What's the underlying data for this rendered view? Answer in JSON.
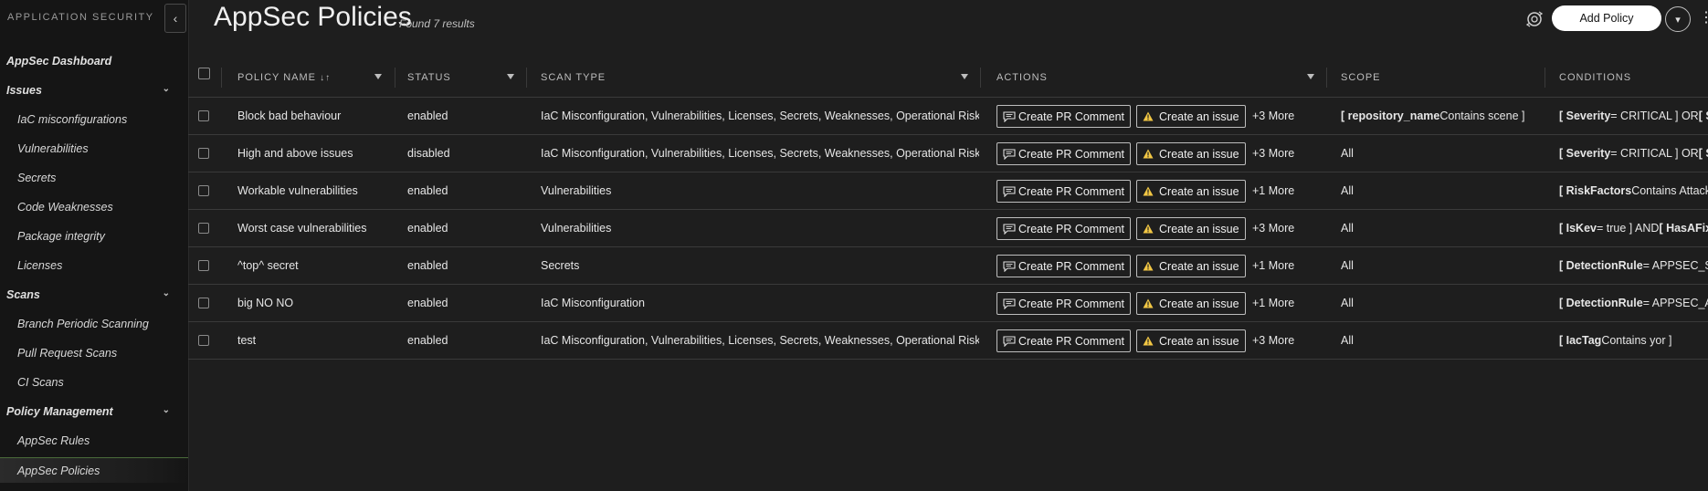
{
  "sidebar": {
    "title": "APPLICATION SECURITY",
    "collapse_glyph": "‹",
    "items": [
      {
        "label": "AppSec Dashboard",
        "kind": "top"
      },
      {
        "label": "Issues",
        "kind": "top",
        "chevron": "⌄"
      },
      {
        "label": "IaC misconfigurations",
        "kind": "sub"
      },
      {
        "label": "Vulnerabilities",
        "kind": "sub"
      },
      {
        "label": "Secrets",
        "kind": "sub"
      },
      {
        "label": "Code Weaknesses",
        "kind": "sub"
      },
      {
        "label": "Package integrity",
        "kind": "sub"
      },
      {
        "label": "Licenses",
        "kind": "sub"
      },
      {
        "label": "Scans",
        "kind": "top",
        "chevron": "⌄"
      },
      {
        "label": "Branch Periodic Scanning",
        "kind": "sub"
      },
      {
        "label": "Pull Request Scans",
        "kind": "sub"
      },
      {
        "label": "CI Scans",
        "kind": "sub"
      },
      {
        "label": "Policy Management",
        "kind": "top",
        "chevron": "⌄"
      },
      {
        "label": "AppSec Rules",
        "kind": "sub"
      },
      {
        "label": "AppSec Policies",
        "kind": "sub",
        "active": true
      }
    ]
  },
  "header": {
    "title": "AppSec Policies",
    "results": "Found 7 results",
    "add_button": "Add Policy",
    "dropdown_glyph": "▾",
    "kebab_glyph": "⋮"
  },
  "table": {
    "columns": {
      "policy_name": "POLICY NAME",
      "sort_glyph": "↓↑",
      "status": "STATUS",
      "scan_type": "SCAN TYPE",
      "actions": "ACTIONS",
      "scope": "SCOPE",
      "conditions": "CONDITIONS"
    },
    "action_labels": {
      "pr_comment": "Create PR Comment",
      "issue": "Create an issue"
    },
    "rows": [
      {
        "name": "Block bad behaviour",
        "status": "enabled",
        "scan_type": "IaC Misconfiguration, Vulnerabilities, Licenses, Secrets, Weaknesses, Operational Risk",
        "more": "+3 More",
        "scope": [
          {
            "b": "[ repository_name"
          },
          {
            "t": " Contains scene ]"
          }
        ],
        "conditions": [
          {
            "b": "[ Severity"
          },
          {
            "t": " = CRITICAL ] OR "
          },
          {
            "b": "[ Se"
          }
        ]
      },
      {
        "name": "High and above issues",
        "status": "disabled",
        "scan_type": "IaC Misconfiguration, Vulnerabilities, Licenses, Secrets, Weaknesses, Operational Risk",
        "more": "+3 More",
        "scope": [
          {
            "t": "All"
          }
        ],
        "conditions": [
          {
            "b": "[ Severity"
          },
          {
            "t": " = CRITICAL ] OR "
          },
          {
            "b": "[ Se"
          }
        ]
      },
      {
        "name": "Workable vulnerabilities",
        "status": "enabled",
        "scan_type": "Vulnerabilities",
        "more": "+1 More",
        "scope": [
          {
            "t": "All"
          }
        ],
        "conditions": [
          {
            "b": "[ RiskFactors"
          },
          {
            "t": " Contains Attack v"
          }
        ]
      },
      {
        "name": "Worst case vulnerabilities",
        "status": "enabled",
        "scan_type": "Vulnerabilities",
        "more": "+3 More",
        "scope": [
          {
            "t": "All"
          }
        ],
        "conditions": [
          {
            "b": "[ IsKev"
          },
          {
            "t": " = true ] AND "
          },
          {
            "b": "[ HasAFix"
          }
        ]
      },
      {
        "name": "^top^ secret",
        "status": "enabled",
        "scan_type": "Secrets",
        "more": "+1 More",
        "scope": [
          {
            "t": "All"
          }
        ],
        "conditions": [
          {
            "b": "[ DetectionRule"
          },
          {
            "t": " = APPSEC_SEC"
          }
        ]
      },
      {
        "name": "big NO NO",
        "status": "enabled",
        "scan_type": "IaC Misconfiguration",
        "more": "+1 More",
        "scope": [
          {
            "t": "All"
          }
        ],
        "conditions": [
          {
            "b": "[ DetectionRule"
          },
          {
            "t": " = APPSEC_AW"
          }
        ]
      },
      {
        "name": "test",
        "status": "enabled",
        "scan_type": "IaC Misconfiguration, Vulnerabilities, Licenses, Secrets, Weaknesses, Operational Risk",
        "more": "+3 More",
        "scope": [
          {
            "t": "All"
          }
        ],
        "conditions": [
          {
            "b": "[ IacTag"
          },
          {
            "t": " Contains yor ]"
          }
        ]
      }
    ]
  },
  "colors": {
    "background": "#1e1e1e",
    "sidebar": "#151515",
    "warning_icon": "#f2c744",
    "active_accent": "#4a6b3a"
  },
  "icons": {
    "collapse": "chevron-left-icon",
    "sync": "sync-icon",
    "filter": "filter-icon",
    "comment": "comment-icon",
    "warning": "warning-icon"
  }
}
